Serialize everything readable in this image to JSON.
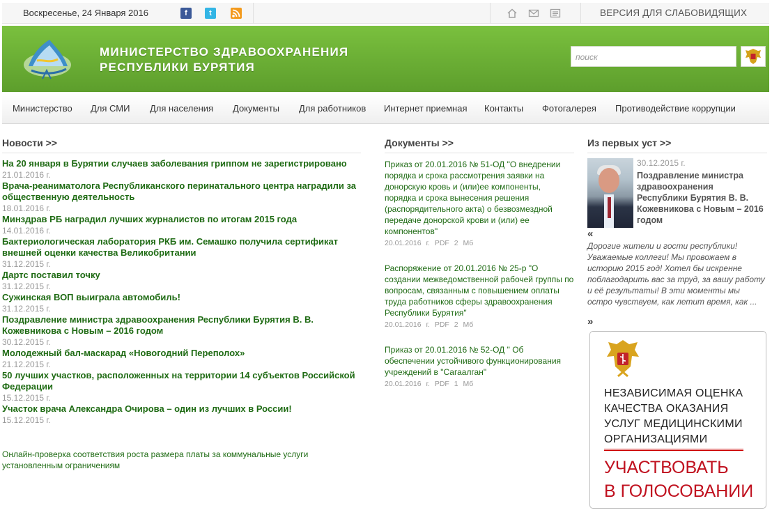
{
  "topbar": {
    "date": "Воскресенье, 24 Января 2016",
    "facebook_icon": "f",
    "twitter_icon": "t",
    "rss_icon": "rss",
    "vision_label": "ВЕРСИЯ ДЛЯ СЛАБОВИДЯЩИХ"
  },
  "header": {
    "title_line1": "МИНИСТЕРСТВО ЗДРАВООХРАНЕНИЯ",
    "title_line2": "РЕСПУБЛИКИ БУРЯТИЯ",
    "search_placeholder": "поиск"
  },
  "nav": {
    "items": [
      "Министерство",
      "Для СМИ",
      "Для населения",
      "Документы",
      "Для работников",
      "Интернет приемная",
      "Контакты",
      "Фотогалерея",
      "Противодействие коррупции"
    ]
  },
  "news": {
    "heading": "Новости >>",
    "items": [
      {
        "title": "На 20 января в Бурятии случаев заболевания гриппом не зарегистрировано",
        "date": "21.01.2016 г."
      },
      {
        "title": "Врача-реаниматолога Республиканского перинатального центра наградили за общественную деятельность",
        "date": "18.01.2016 г."
      },
      {
        "title": "Минздрав РБ наградил лучших журналистов по итогам 2015 года",
        "date": "14.01.2016 г."
      },
      {
        "title": "Бактериологическая лаборатория РКБ им. Семашко получила сертификат внешней оценки качества Великобритании",
        "date": "31.12.2015 г."
      },
      {
        "title": "Дартс поставил точку",
        "date": "31.12.2015 г."
      },
      {
        "title": "Сужинская ВОП выиграла автомобиль!",
        "date": "31.12.2015 г."
      },
      {
        "title": "Поздравление министра здравоохранения Республики Бурятия В. В. Кожевникова с Новым – 2016 годом",
        "date": "30.12.2015 г."
      },
      {
        "title": "Молодежный бал-маскарад «Новогодний Переполох»",
        "date": "21.12.2015 г."
      },
      {
        "title": "50 лучших участков, расположенных на территории 14 субъектов Российской Федерации",
        "date": "15.12.2015 г."
      },
      {
        "title": "Участок врача Александра Очирова – один из лучших в России!",
        "date": "15.12.2015 г."
      }
    ],
    "online_link": "Онлайн-проверка соответствия роста размера платы за коммунальные услуги установленным ограничениям"
  },
  "documents": {
    "heading": "Документы >>",
    "items": [
      {
        "title": "Приказ от 20.01.2016 № 51-ОД \"О внедрении порядка и срока рассмотрения заявки на донорскую кровь и (или)ее компоненты, порядка и срока вынесения решения (распорядительного акта) о безвозмездной передаче донорской крови и (или) ее компонентов\"",
        "meta": "20.01.2016 г. PDF 2 Мб"
      },
      {
        "title": "Распоряжение от 20.01.2016 № 25-р \"О создании межведомственной рабочей группы по вопросам, связанным с повышением оплаты труда работников сферы здравоохранения Республики Бурятия\"",
        "meta": "20.01.2016 г. PDF 2 Мб"
      },
      {
        "title": "Приказ от 20.01.2016 № 52-ОД \" Об обеспечении устойчивого функционирования учреждений в \"Сагаалган\"",
        "meta": "20.01.2016 г. PDF 1 Мб"
      }
    ]
  },
  "quotes": {
    "heading": "Из первых уст >>",
    "date": "30.12.2015 г.",
    "title": "Поздравление министра здравоохранения Республики Бурятия В. В. Кожевникова с Новым – 2016 годом",
    "open_mark": "«",
    "close_mark": "»",
    "text": "Дорогие жители и гости республики! Уважаемые коллеги! Мы провожаем в историю 2015 год! Хотел бы искренне поблагодарить вас за труд, за вашу работу и её результаты! В эти моменты мы остро чувствуем, как летит время, как ..."
  },
  "banner": {
    "text_lines": [
      "НЕЗАВИСИМАЯ ОЦЕНКА",
      "КАЧЕСТВА ОКАЗАНИЯ",
      "УСЛУГ МЕДИЦИНСКИМИ",
      "ОРГАНИЗАЦИЯМИ"
    ],
    "cta_lines": [
      "УЧАСТВОВАТЬ",
      "В ГОЛОСОВАНИИ"
    ]
  },
  "colors": {
    "header_green": "#6bb034",
    "link_green": "#1f6b14",
    "banner_red": "#c0111f"
  }
}
